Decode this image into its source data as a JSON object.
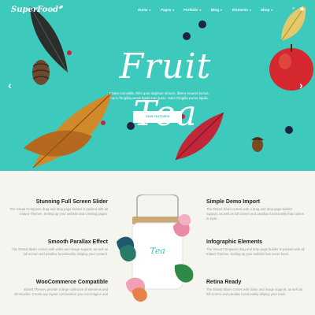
{
  "nav": {
    "logo": "SuperFood",
    "items": [
      {
        "label": "Home"
      },
      {
        "label": "Pages"
      },
      {
        "label": "Portfolio"
      },
      {
        "label": "Blog"
      },
      {
        "label": "Elements"
      },
      {
        "label": "Shop"
      }
    ],
    "icons": [
      "search-icon",
      "cart-icon"
    ]
  },
  "hero": {
    "title": "Fruit Tea",
    "subtitle_line1": "Etiam convallis, felis quis dapibus dictum, libero mauris luctus,",
    "subtitle_line2": "nunc fringilla purus ligula non justo. Nam fringilla purus ligula.",
    "button": "VIEW FEATURES",
    "colors": {
      "background": "#3ec9bd",
      "text": "#ffffff"
    }
  },
  "product": {
    "label": "Tea"
  },
  "features": {
    "left": [
      {
        "title": "Stunning Full Screen Slider",
        "desc": "The Visual Composer drag and drop page builder is packed with all Elated Themes. Setting up your website and creating pages."
      },
      {
        "title": "Smooth Parallax Effect",
        "desc": "The Elated Slider comes with video and image support, as well as full screen and parallax functionality. Display your content."
      },
      {
        "title": "WooCommerce Compatible",
        "desc": "Elated Themes provide a large collection of elements and shortcodes. Create any layout combination you can imagine and"
      }
    ],
    "right": [
      {
        "title": "Simple Demo Import",
        "desc": "The Elated Slider comes with a drag and drop page builder support, as well as full screen and parallax functionality that comes in style."
      },
      {
        "title": "Infographic Elements",
        "desc": "The Visual Composer drag and drop page builder is packed with all Elated Themes. Setting up your website has never been."
      },
      {
        "title": "Retina Ready",
        "desc": "The Elated Slider comes with video and image support, as well as full screen and parallax functionality display your main."
      }
    ]
  }
}
